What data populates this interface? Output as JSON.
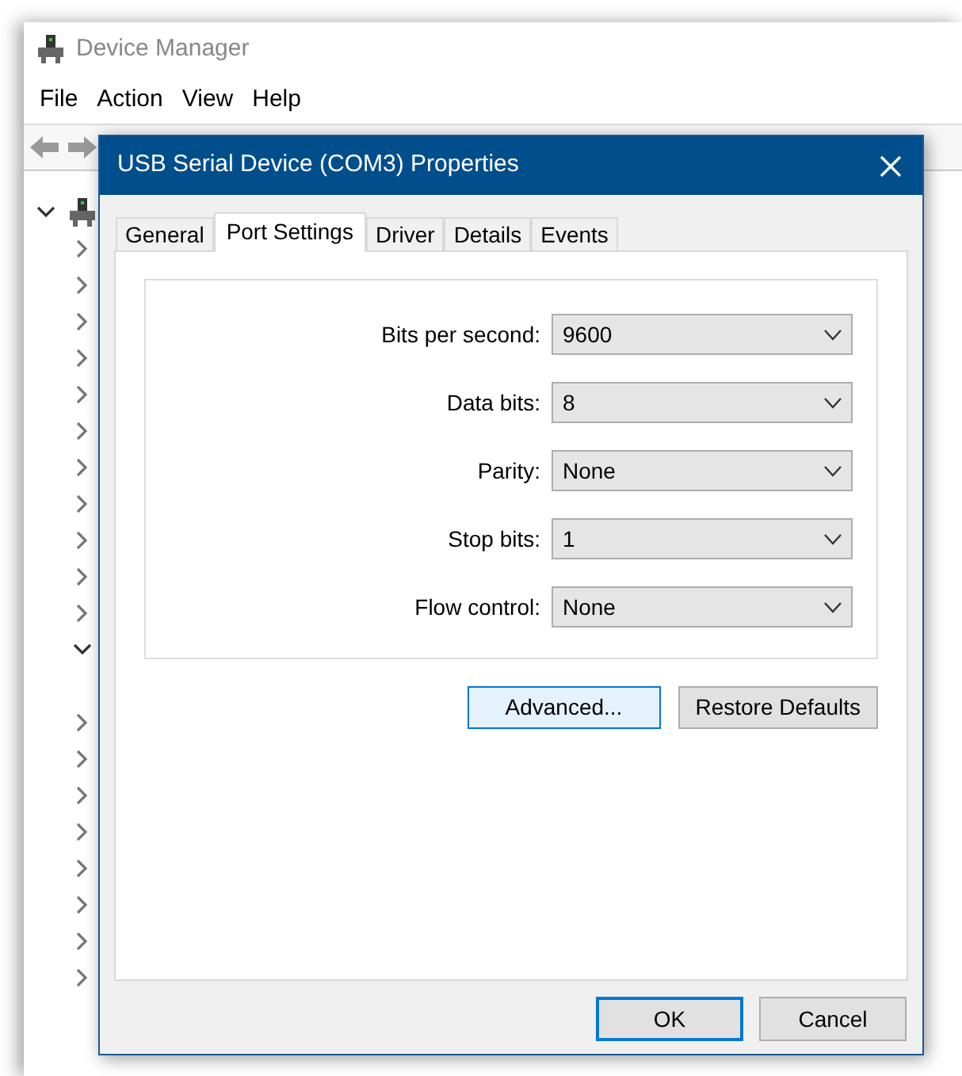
{
  "window": {
    "title": "Device Manager"
  },
  "menu": [
    "File",
    "Action",
    "View",
    "Help"
  ],
  "tree": {
    "expanded": true,
    "children": [
      {
        "expanded": false
      },
      {
        "expanded": false
      },
      {
        "expanded": false
      },
      {
        "expanded": false
      },
      {
        "expanded": false
      },
      {
        "expanded": false
      },
      {
        "expanded": false
      },
      {
        "expanded": false
      },
      {
        "expanded": false
      },
      {
        "expanded": false
      },
      {
        "expanded": false
      },
      {
        "expanded": true
      },
      {
        "expanded": false
      },
      {
        "expanded": false
      },
      {
        "expanded": false
      },
      {
        "expanded": false
      },
      {
        "expanded": false
      },
      {
        "expanded": false
      },
      {
        "expanded": false
      },
      {
        "expanded": false
      }
    ]
  },
  "dialog": {
    "title": "USB Serial Device (COM3) Properties",
    "tabs": [
      {
        "label": "General",
        "selected": false
      },
      {
        "label": "Port Settings",
        "selected": true
      },
      {
        "label": "Driver",
        "selected": false
      },
      {
        "label": "Details",
        "selected": false
      },
      {
        "label": "Events",
        "selected": false
      }
    ],
    "settings": [
      {
        "label": "Bits per second:",
        "value": "9600"
      },
      {
        "label": "Data bits:",
        "value": "8"
      },
      {
        "label": "Parity:",
        "value": "None"
      },
      {
        "label": "Stop bits:",
        "value": "1"
      },
      {
        "label": "Flow control:",
        "value": "None"
      }
    ],
    "panel_buttons": [
      {
        "label": "Advanced...",
        "focused": true
      },
      {
        "label": "Restore Defaults",
        "focused": false
      }
    ],
    "buttons": [
      {
        "label": "OK",
        "default": true
      },
      {
        "label": "Cancel",
        "default": false
      }
    ]
  }
}
